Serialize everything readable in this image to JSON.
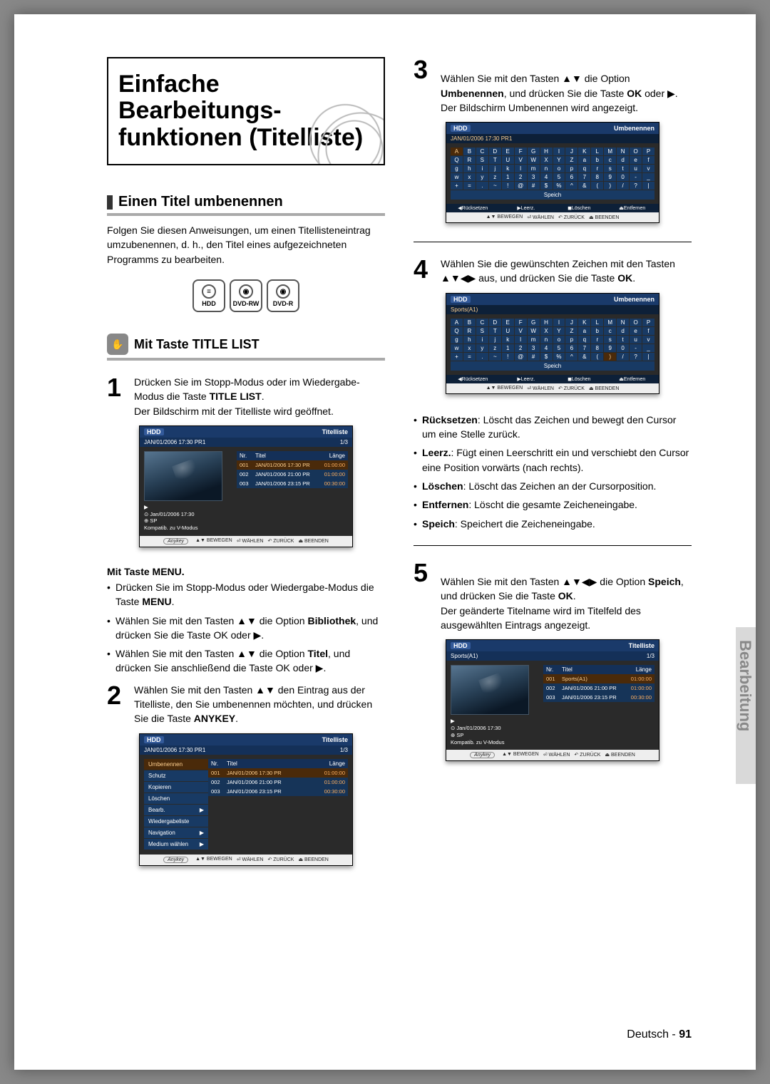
{
  "side_tab": "Bearbeitung",
  "footer": {
    "lang": "Deutsch",
    "dash": " - ",
    "page": "91"
  },
  "title": "Einfache Bearbeitungs-\nfunktionen (Titelliste)",
  "section1": {
    "heading": "Einen Titel umbenennen",
    "intro": "Folgen Sie diesen Anweisungen, um einen Titellisteneintrag umzubenennen, d. h., den Titel eines aufgezeichneten Programms zu bearbeiten.",
    "badges": [
      "HDD",
      "DVD-RW",
      "DVD-R"
    ],
    "subheading": "Mit Taste TITLE LIST"
  },
  "step1": {
    "num": "1",
    "text1": "Drücken Sie im Stopp-Modus oder im Wiedergabe-Modus die Taste ",
    "b1": "TITLE LIST",
    "text2": ".\nDer Bildschirm mit der Titelliste wird geöffnet."
  },
  "menu_heading": "Mit Taste MENU.",
  "menu_bullets": [
    {
      "pre": "Drücken Sie im Stopp-Modus oder Wiedergabe-Modus die Taste ",
      "b": "MENU",
      "post": "."
    },
    {
      "pre": "Wählen Sie mit den Tasten ▲▼ die Option ",
      "b": "Bibliothek",
      "post": ", und drücken Sie die Taste OK oder ▶."
    },
    {
      "pre": "Wählen Sie mit den Tasten ▲▼ die Option ",
      "b": "Titel",
      "post": ", und drücken Sie anschließend die Taste OK oder ▶."
    }
  ],
  "step2": {
    "num": "2",
    "text": "Wählen Sie mit den Tasten ▲▼ den Eintrag aus der Titelliste, den Sie umbenennen möchten, und drücken Sie die Taste ",
    "b": "ANYKEY",
    "post": "."
  },
  "step3": {
    "num": "3",
    "t1": "Wählen Sie mit den Tasten ▲▼ die Option ",
    "b1": "Umbenennen",
    "t2": ", und drücken Sie die Taste ",
    "b2": "OK",
    "t3": " oder ▶.\nDer Bildschirm Umbenennen wird angezeigt."
  },
  "step4": {
    "num": "4",
    "t1": "Wählen Sie die gewünschten Zeichen mit den Tasten ▲▼◀▶ aus, und drücken Sie die Taste ",
    "b1": "OK",
    "t2": "."
  },
  "defs": [
    {
      "b": "Rücksetzen",
      "t": ": Löscht das Zeichen und bewegt den Cursor um eine Stelle zurück."
    },
    {
      "b": "Leerz.",
      "t": ": Fügt einen Leerschritt ein und verschiebt den Cursor eine Position vorwärts (nach rechts)."
    },
    {
      "b": "Löschen",
      "t": ": Löscht das Zeichen an der Cursorposition."
    },
    {
      "b": "Entfernen",
      "t": ": Löscht die gesamte Zeicheneingabe."
    },
    {
      "b": "Speich",
      "t": ": Speichert die Zeicheneingabe."
    }
  ],
  "step5": {
    "num": "5",
    "t1": "Wählen Sie mit den Tasten ▲▼◀▶ die Option ",
    "b1": "Speich",
    "t2": ", und drücken Sie die Taste ",
    "b2": "OK",
    "t3": ".\nDer geänderte Titelname wird im Titelfeld des ausgewählten Eintrags angezeigt."
  },
  "osd_common": {
    "hdd": "HDD",
    "anykey": "Anykey",
    "foot": [
      "▲▼ BEWEGEN",
      "⏎ WÄHLEN",
      "↶ ZURÜCK",
      "⏏ BEENDEN"
    ]
  },
  "osd1": {
    "title": "Titelliste",
    "sub": "JAN/01/2006 17:30 PR1",
    "count": "1/3",
    "headers": [
      "Nr.",
      "Titel",
      "Länge"
    ],
    "rows": [
      [
        "001",
        "JAN/01/2006 17:30 PR",
        "01:00:00"
      ],
      [
        "002",
        "JAN/01/2006 21:00 PR",
        "01:00:00"
      ],
      [
        "003",
        "JAN/01/2006 23:15 PR",
        "00:30:00"
      ]
    ],
    "meta": [
      "▶",
      "⊙ Jan/01/2006 17:30",
      "⊕ SP",
      "Kompatib. zu V-Modus"
    ]
  },
  "osd2": {
    "title": "Titelliste",
    "sub": "JAN/01/2006 17:30 PR1",
    "count": "1/3",
    "menu": [
      "Umbenennen",
      "Schutz",
      "Kopieren",
      "Löschen",
      "Bearb.",
      "Wiedergabeliste",
      "Navigation",
      "Medium wählen"
    ],
    "headers": [
      "Nr.",
      "Titel",
      "Länge"
    ],
    "rows": [
      [
        "001",
        "JAN/01/2006 17:30 PR",
        "01:00:00"
      ],
      [
        "002",
        "JAN/01/2006 21:00 PR",
        "01:00:00"
      ],
      [
        "003",
        "JAN/01/2006 23:15 PR",
        "00:30:00"
      ]
    ]
  },
  "osd3": {
    "title": "Umbenennen",
    "sub": "JAN/01/2006 17:30 PR1",
    "rows": [
      "A B C D E F G H I J K L M N O P",
      "Q R S T U V W X Y Z a b c d e f",
      "g h i j k l m n o p q r s t u v",
      "w x y z 1 2 3 4 5 6 7 8 9 0 - _",
      "+ = . ~ ! @ # $ % ^ & ( ) / ? |"
    ],
    "speich": "Speich",
    "kfoot": [
      "◀Rücksetzen",
      "▶Leerz.",
      "◼Löschen",
      "⏏Entfernen"
    ]
  },
  "osd4": {
    "title": "Umbenennen",
    "name": "Sports(A1)",
    "rows": [
      "A B C D E F G H I J K L M N O P",
      "Q R S T U V W X Y Z a b c d e f",
      "g h i j k l m n o p q r s t u v",
      "w x y z 1 2 3 4 5 6 7 8 9 0 - _",
      "+ = . ~ ! @ # $ % ^ & ( ) / ? |"
    ],
    "speich": "Speich",
    "kfoot": [
      "◀Rücksetzen",
      "▶Leerz.",
      "◼Löschen",
      "⏏Entfernen"
    ]
  },
  "osd5": {
    "title": "Titelliste",
    "sub": "Sports(A1)",
    "count": "1/3",
    "headers": [
      "Nr.",
      "Titel",
      "Länge"
    ],
    "rows": [
      [
        "001",
        "Sports(A1)",
        "01:00:00"
      ],
      [
        "002",
        "JAN/01/2006 21:00 PR",
        "01:00:00"
      ],
      [
        "003",
        "JAN/01/2006 23:15 PR",
        "00:30:00"
      ]
    ],
    "meta": [
      "▶",
      "⊙ Jan/01/2006 17:30",
      "⊕ SP",
      "Kompatib. zu V-Modus"
    ]
  }
}
